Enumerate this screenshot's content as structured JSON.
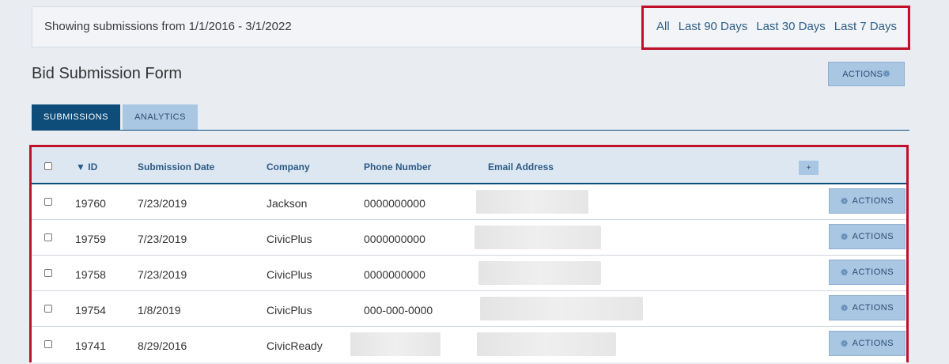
{
  "filter": {
    "text": "Showing submissions from 1/1/2016 - 3/1/2022",
    "ranges": [
      "All",
      "Last 90 Days",
      "Last 30 Days",
      "Last 7 Days"
    ]
  },
  "form_title": "Bid Submission Form",
  "top_actions_label": "ACTIONS",
  "tabs": {
    "submissions": "SUBMISSIONS",
    "analytics": "ANALYTICS"
  },
  "table": {
    "headers": {
      "id": "ID",
      "sort_indicator": "▼",
      "date": "Submission Date",
      "company": "Company",
      "phone": "Phone Number",
      "email": "Email Address"
    },
    "add_column_label": "+",
    "row_action_label": "ACTIONS",
    "rows": [
      {
        "id": "19760",
        "date": "7/23/2019",
        "company": "Jackson",
        "phone": "0000000000"
      },
      {
        "id": "19759",
        "date": "7/23/2019",
        "company": "CivicPlus",
        "phone": "0000000000"
      },
      {
        "id": "19758",
        "date": "7/23/2019",
        "company": "CivicPlus",
        "phone": "0000000000"
      },
      {
        "id": "19754",
        "date": "1/8/2019",
        "company": "CivicPlus",
        "phone": "000-000-0000"
      },
      {
        "id": "19741",
        "date": "8/29/2016",
        "company": "CivicReady",
        "phone": ""
      }
    ]
  },
  "icons": {
    "actions": "gear-icon",
    "sort": "sort-desc-icon"
  },
  "colors": {
    "primary": "#0e4c7a",
    "button": "#a9c6e3",
    "highlight": "#c0102a",
    "link": "#2e5f87"
  }
}
